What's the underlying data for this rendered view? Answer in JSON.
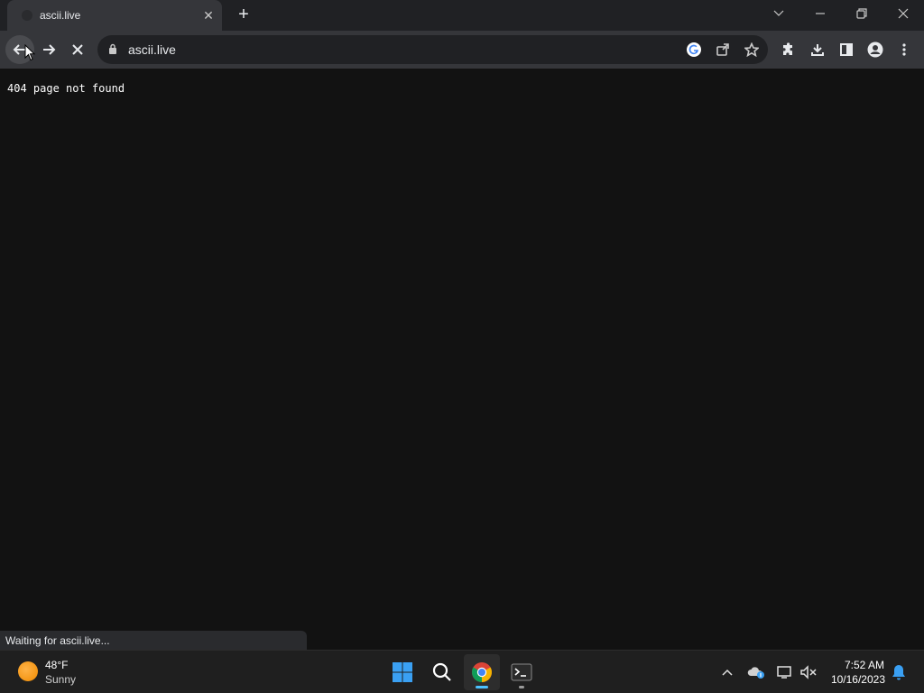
{
  "browser": {
    "tab": {
      "title": "ascii.live",
      "close_icon": "close-icon"
    },
    "new_tab_icon": "plus-icon",
    "window_controls": [
      "chevron-down-icon",
      "minimize-icon",
      "restore-icon",
      "close-icon"
    ],
    "toolbar": {
      "back_icon": "arrow-left-icon",
      "forward_icon": "arrow-right-icon",
      "stop_icon": "close-icon",
      "url": "ascii.live",
      "omnibox_icons": [
        "google-icon",
        "share-icon",
        "star-icon"
      ],
      "right_icons": [
        "extensions-icon",
        "download-icon",
        "side-panel-icon",
        "profile-icon",
        "more-icon"
      ]
    }
  },
  "page": {
    "text": "404 page not found",
    "status": "Waiting for ascii.live..."
  },
  "taskbar": {
    "weather": {
      "temp": "48°F",
      "condition": "Sunny"
    },
    "apps": [
      "windows-start-icon",
      "search-icon",
      "chrome-icon",
      "terminal-icon"
    ],
    "tray_icons": [
      "chevron-up-icon",
      "onedrive-icon",
      "display-icon",
      "volume-muted-icon",
      "bell-icon"
    ],
    "clock": {
      "time": "7:52 AM",
      "date": "10/16/2023"
    }
  },
  "colors": {
    "page_bg": "#121212",
    "toolbar_bg": "#35363a",
    "tabstrip_bg": "#202124",
    "taskbar_bg": "#1f1f1f",
    "accent": "#4cc2ff"
  }
}
